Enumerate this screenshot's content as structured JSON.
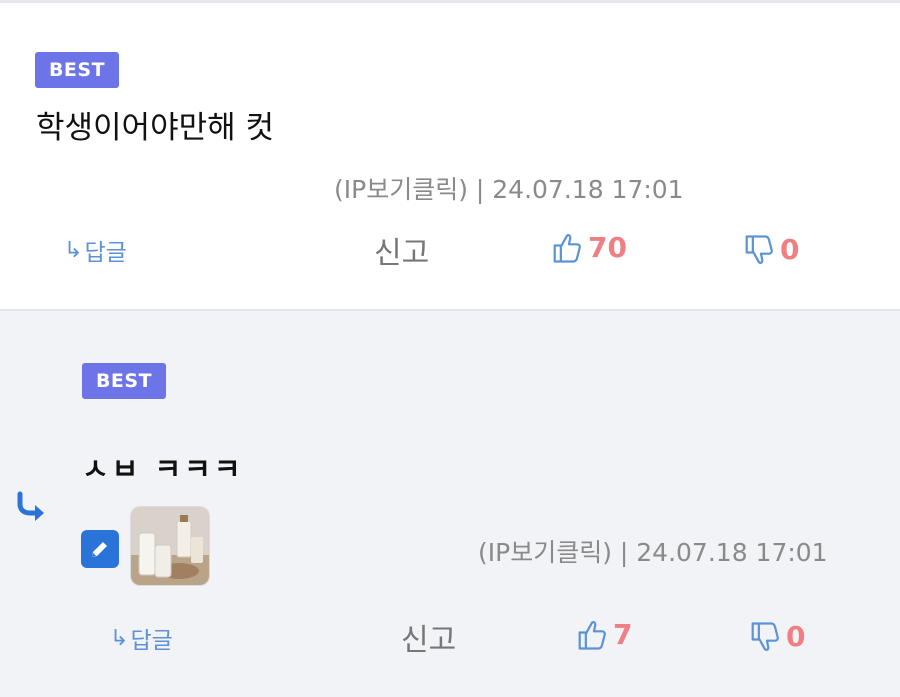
{
  "comments": [
    {
      "badge": "BEST",
      "text": "학생이어야만해 컷",
      "meta": "(IP보기클릭) | 24.07.18 17:01",
      "reply_label": "답글",
      "report_label": "신고",
      "likes": "70",
      "dislikes": "0"
    },
    {
      "badge": "BEST",
      "text": "ㅅㅂ ㅋㅋㅋ",
      "meta": "(IP보기클릭) | 24.07.18 17:01",
      "reply_label": "답글",
      "report_label": "신고",
      "likes": "7",
      "dislikes": "0",
      "has_image": true,
      "icons": [
        "reply-arrow-icon",
        "pencil-icon",
        "milk-image"
      ]
    }
  ],
  "colors": {
    "badge": "#6c74e8",
    "reply": "#5c93d6",
    "vote_count": "#ef7f84",
    "reply_bg": "#f2f3f6",
    "edit_button": "#2a73d8"
  }
}
